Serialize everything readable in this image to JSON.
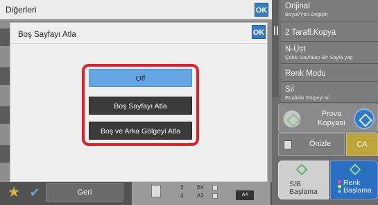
{
  "right_panel": {
    "items": [
      {
        "main": "Orijinal",
        "sub": "Boyut/Yön Değiştir"
      },
      {
        "main": "2 Tarafl.Kopya",
        "sub": ""
      },
      {
        "main": "N-Üst",
        "sub": "Çoklu Sayfaları Bir Sayfa yap"
      },
      {
        "main": "Renk Modu",
        "sub": ""
      },
      {
        "main": "Sil",
        "sub": "Etraftaki Gölgeyi sil"
      }
    ],
    "prova_label": "Prova Kopyası",
    "onizle_label": "Önizle",
    "ca_label": "CA",
    "sb_start_label": "S/B Başlama",
    "renk_start_label": "Renk Başlama"
  },
  "bottom": {
    "geri_label": "Geri",
    "tray3": "3",
    "tray3_size": "B4",
    "tray4": "4",
    "tray4_size": "A3",
    "paper": "A4"
  },
  "outer_dialog": {
    "title": "Diğerleri",
    "ok": "OK"
  },
  "inner_dialog": {
    "title": "Boş Sayfayı Atla",
    "ok": "OK",
    "options": [
      {
        "label": "Off",
        "selected": true
      },
      {
        "label": "Boş Sayfayı Atla",
        "selected": false
      },
      {
        "label": "Boş ve Arka Gölgeyi Atla",
        "selected": false
      }
    ]
  },
  "colors": {
    "selected_option": "#63a6e3",
    "option_dark": "#3b3b3b",
    "highlight_frame": "#e0202c",
    "ok_button": "#3a79c4",
    "renk_start": "#2a6fc2",
    "ca_button": "#bfa43a"
  },
  "icons": [
    "star-icon",
    "check-icon",
    "preview-icon",
    "green-diamond-icon",
    "blue-diamond-icon"
  ]
}
